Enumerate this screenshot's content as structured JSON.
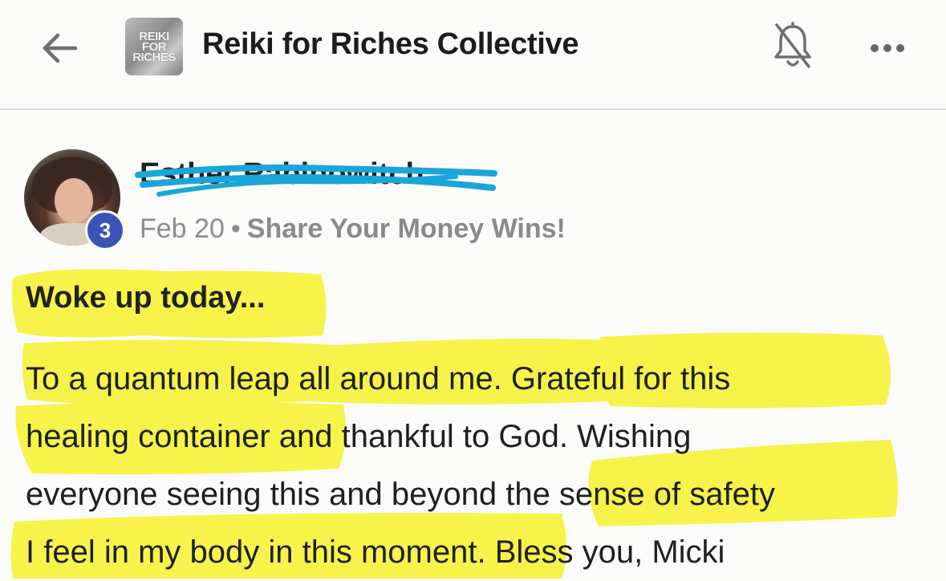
{
  "header": {
    "back_icon": "back-arrow-icon",
    "group_logo_text": "REIKI\nFOR\nRICHES",
    "group_name": "Reiki for Riches Collective",
    "bell_icon": "bell-muted-icon",
    "more_icon": "more-dots-icon"
  },
  "post": {
    "author_name": "Esther Rabinowitch",
    "author_rank": "3",
    "date": "Feb 20",
    "separator": "•",
    "category": "Share Your Money Wins!",
    "title": "Woke up today...",
    "body_lines": [
      "To a quantum leap all around me. Grateful for this",
      "healing container and thankful to God. Wishing",
      "everyone seeing this and beyond the sense of safety",
      "I feel in my body in this moment. Bless you, Micki"
    ]
  },
  "colors": {
    "highlight": "#f6f23c",
    "redaction": "#1aa6d8",
    "badge": "#3b53b7"
  }
}
